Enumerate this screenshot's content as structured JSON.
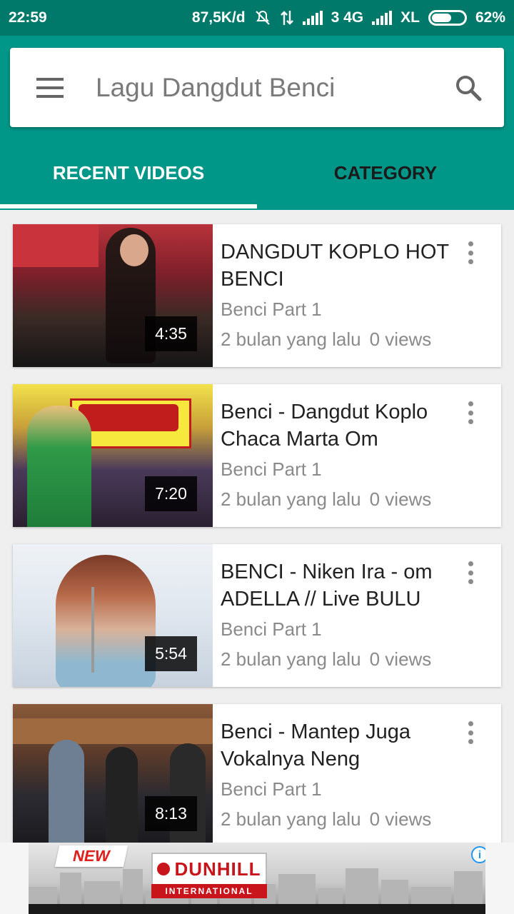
{
  "status_bar": {
    "time": "22:59",
    "speed": "87,5K/d",
    "sim_label": "3 4G",
    "carrier": "XL",
    "battery": "62%",
    "battery_level": 0.62
  },
  "app_bar": {
    "title": "Lagu Dangdut Benci",
    "menu_icon": "menu-icon",
    "search_icon": "search-icon"
  },
  "tabs": [
    {
      "label": "RECENT VIDEOS",
      "selected": true
    },
    {
      "label": "CATEGORY",
      "selected": false
    }
  ],
  "colors": {
    "primary": "#009688",
    "primary_dark": "#00796b",
    "accent": "#ffffff",
    "ad_blue": "#2196f3"
  },
  "videos": [
    {
      "title": "DANGDUT KOPLO HOT BENCI",
      "category": "Benci Part 1",
      "age": "2 bulan yang lalu",
      "views": "0 views",
      "duration": "4:35"
    },
    {
      "title": "Benci - Dangdut Koplo Chaca Marta Om",
      "category": "Benci Part 1",
      "age": "2 bulan yang lalu",
      "views": "0 views",
      "duration": "7:20"
    },
    {
      "title": "BENCI - Niken Ira - om ADELLA // Live BULU",
      "category": "Benci Part 1",
      "age": "2 bulan yang lalu",
      "views": "0 views",
      "duration": "5:54"
    },
    {
      "title": "Benci - Mantep Juga Vokalnya Neng",
      "category": "Benci Part 1",
      "age": "2 bulan yang lalu",
      "views": "0 views",
      "duration": "8:13"
    }
  ],
  "ad": {
    "badge": "NEW",
    "brand": "DUNHILL",
    "tagline": "INTERNATIONAL",
    "info": "i",
    "close": "✕"
  }
}
